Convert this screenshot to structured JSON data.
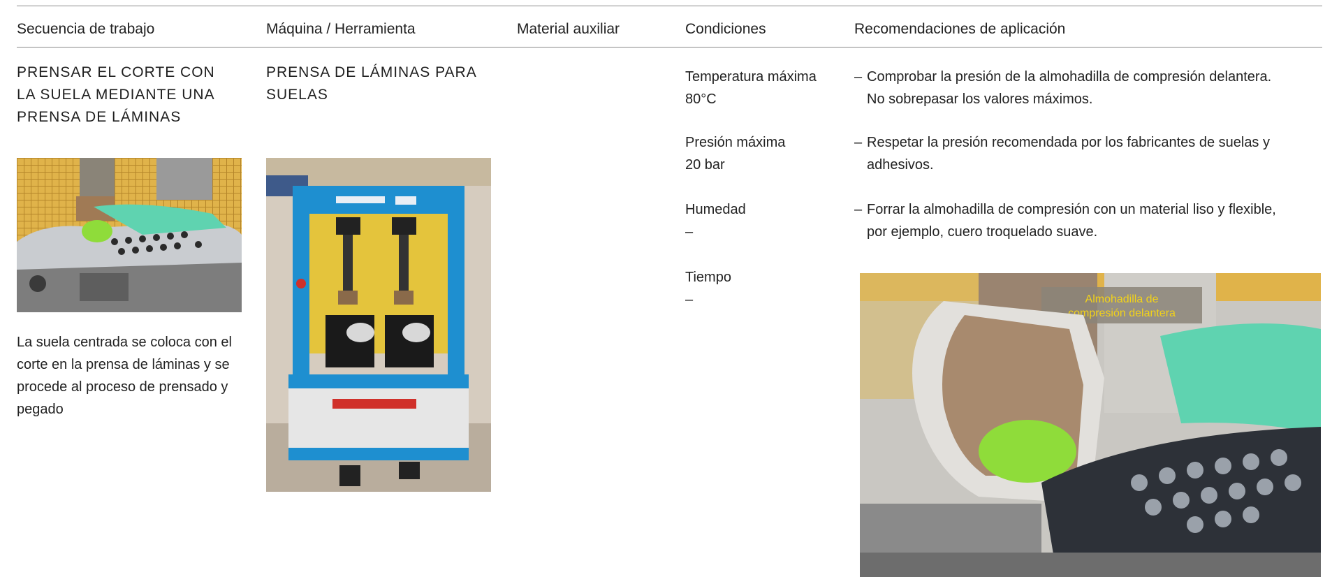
{
  "headers": {
    "sequence": "Secuencia de trabajo",
    "machine": "Máquina / Herramienta",
    "aux": "Material auxiliar",
    "conditions": "Condiciones",
    "recommendations": "Recomendaciones de aplicación"
  },
  "step": {
    "title_lines": [
      "PRENSAR EL CORTE CON",
      "LA SUELA MEDIANTE UNA",
      "PRENSA DE LÁMINAS"
    ],
    "description": "La suela centrada se coloca con el corte en la prensa de láminas y se procede al proceso de prensado y pegado"
  },
  "machine": {
    "title_lines": [
      "PRENSA DE LÁMINAS PARA",
      "SUELAS"
    ]
  },
  "conditions": [
    {
      "label": "Temperatura máxima",
      "value": "80°C"
    },
    {
      "label": "Presión máxima",
      "value": "20 bar"
    },
    {
      "label": "Humedad",
      "value": "–"
    },
    {
      "label": "Tiempo",
      "value": "–"
    }
  ],
  "recommendations": [
    {
      "dash": "–",
      "lines": [
        "Comprobar la presión de la almohadilla de compresión delantera.",
        "No sobrepasar los valores máximos."
      ]
    },
    {
      "dash": "–",
      "lines": [
        "Respetar la presión recomendada por los fabricantes de suelas y",
        "adhesivos."
      ]
    },
    {
      "dash": "–",
      "lines": [
        "Forrar la almohadilla de compresión con un material liso y flexible,",
        "por ejemplo, cuero troquelado suave."
      ]
    }
  ],
  "photo_annotation": {
    "lines": [
      "Almohadilla de",
      "compresión delantera"
    ]
  },
  "colors": {
    "press_blue": "#1e8fd0",
    "annotation_yellow": "#f2d21a",
    "shoe_mint": "#5fd3b0",
    "pad_green": "#8fdc3a"
  }
}
